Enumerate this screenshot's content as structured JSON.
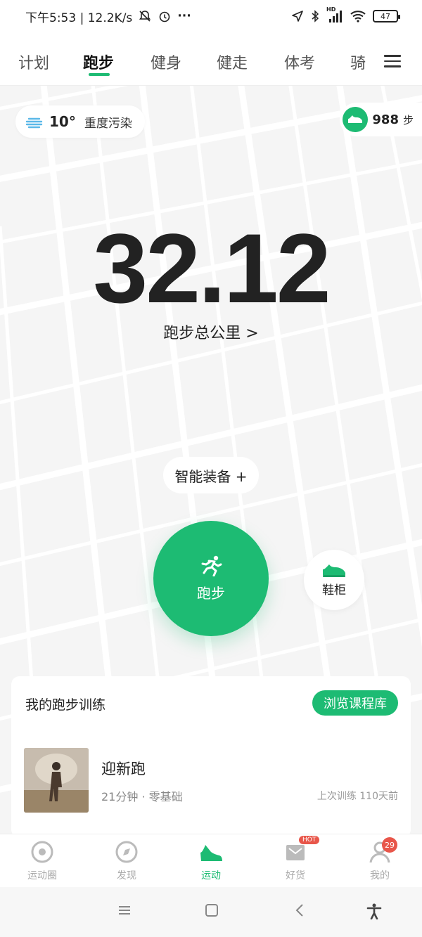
{
  "status_bar": {
    "time_and_speed": "下午5:53 | 12.2K/s",
    "network_hd": "HD",
    "battery": "47",
    "more": "···"
  },
  "tabs": [
    {
      "label": "计划"
    },
    {
      "label": "跑步"
    },
    {
      "label": "健身"
    },
    {
      "label": "健走"
    },
    {
      "label": "体考"
    },
    {
      "label": "骑"
    }
  ],
  "weather": {
    "temperature": "10°",
    "air_quality": "重度污染"
  },
  "steps": {
    "value": "988",
    "unit": "步"
  },
  "running": {
    "total_distance": "32.12",
    "distance_label": "跑步总公里 >",
    "smart_equipment_label": "智能装备 +",
    "run_button_label": "跑步",
    "shoe_cabinet_label": "鞋柜"
  },
  "training_card": {
    "title": "我的跑步训练",
    "browse_label": "浏览课程库",
    "course": {
      "title": "迎新跑",
      "meta": "21分钟  ·  零基础",
      "last_trained": "上次训练 110天前"
    }
  },
  "bottom_nav": [
    {
      "label": "运动圈",
      "icon": "target-icon"
    },
    {
      "label": "发现",
      "icon": "compass-icon"
    },
    {
      "label": "运动",
      "icon": "shoe-icon"
    },
    {
      "label": "好货",
      "icon": "mail-icon",
      "badge": "HOT"
    },
    {
      "label": "我的",
      "icon": "person-icon",
      "badge": "29"
    }
  ],
  "colors": {
    "accent": "#1dbb73",
    "badge": "#e8564a"
  }
}
